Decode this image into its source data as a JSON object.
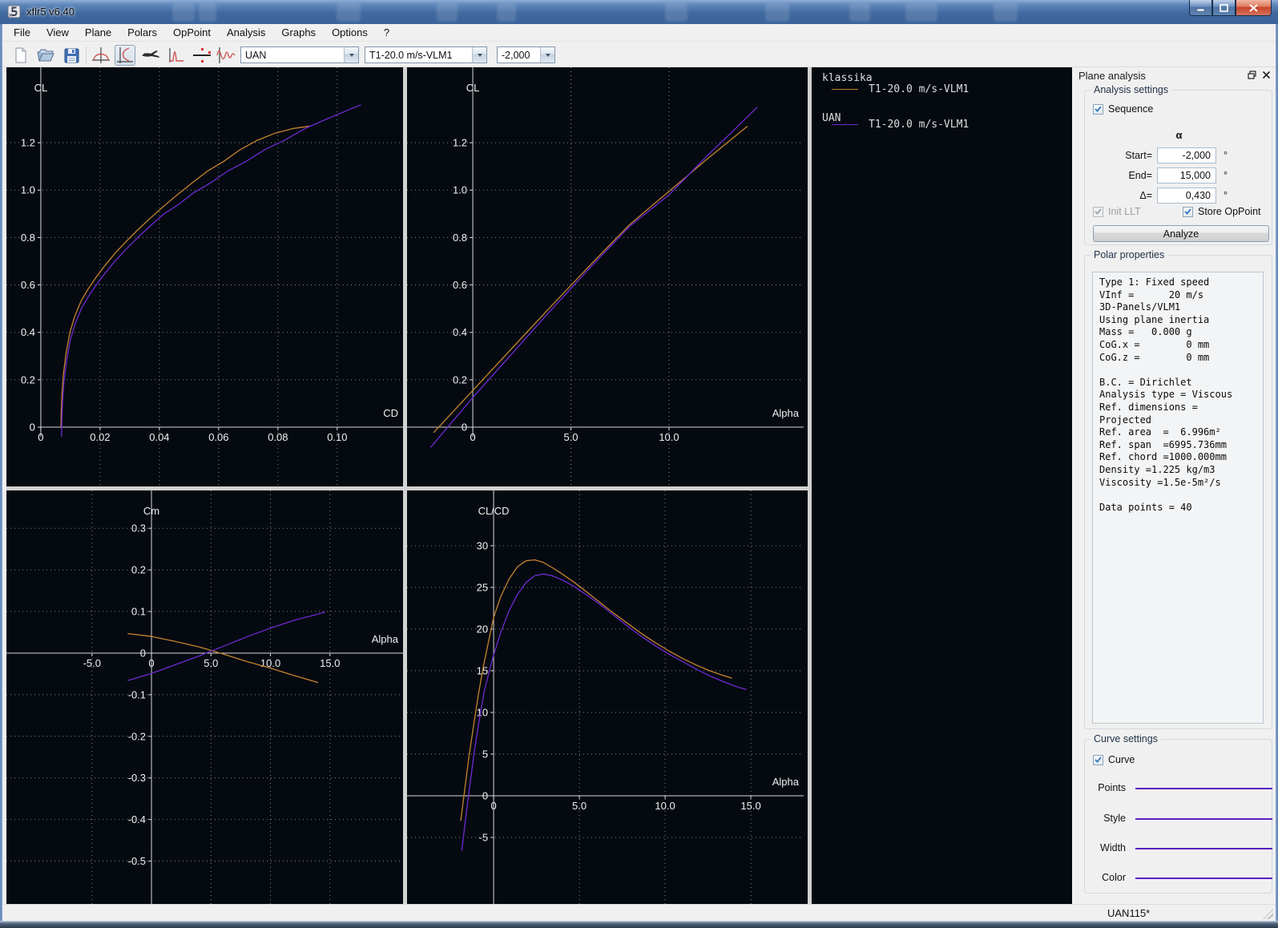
{
  "window": {
    "title": "xflr5 v6.40",
    "controls": [
      "minimize",
      "maximize",
      "close"
    ]
  },
  "menu": {
    "items": [
      "File",
      "View",
      "Plane",
      "Polars",
      "OpPoint",
      "Analysis",
      "Graphs",
      "Options",
      "?"
    ]
  },
  "toolbar": {
    "icons": [
      "new-file-icon",
      "open-file-icon",
      "save-icon",
      "foil-view-icon",
      "polar-view-icon",
      "plane-view-icon",
      "cp-view-icon",
      "oppoint-view-icon",
      "stability-view-icon"
    ],
    "selected_icon": "polar-view-icon",
    "combos": [
      {
        "name": "plane-select",
        "value": "UAN"
      },
      {
        "name": "polar-select",
        "value": "T1-20.0 m/s-VLM1"
      },
      {
        "name": "oppoint-select",
        "value": "-2,000"
      }
    ]
  },
  "legend": {
    "groups": [
      {
        "name": "klassika",
        "polar": "T1-20.0 m/s-VLM1",
        "color": "#c5842e"
      },
      {
        "name": "UAN",
        "polar": "T1-20.0 m/s-VLM1",
        "color": "#6f2ad2"
      }
    ]
  },
  "dock": {
    "title": "Plane analysis",
    "analysis_settings": {
      "title": "Analysis settings",
      "sequence_label": "Sequence",
      "alpha_symbol": "α",
      "rows": [
        {
          "label": "Start=",
          "value": "-2,000",
          "unit": "°"
        },
        {
          "label": "End=",
          "value": "15,000",
          "unit": "°"
        },
        {
          "label": "Δ=",
          "value": "0,430",
          "unit": "°"
        }
      ],
      "init_llt_label": "Init LLT",
      "store_oppoint_label": "Store OpPoint",
      "analyze_label": "Analyze"
    },
    "polar_properties": {
      "title": "Polar properties",
      "lines": [
        "Type 1: Fixed speed",
        "VInf =      20 m/s",
        "3D-Panels/VLM1",
        "Using plane inertia",
        "Mass =   0.000 g",
        "CoG.x =        0 mm",
        "CoG.z =        0 mm",
        "",
        "B.C. = Dirichlet",
        "Analysis type = Viscous",
        "Ref. dimensions =",
        "Projected",
        "Ref. area  =  6.996m²",
        "Ref. span  =6995.736mm",
        "Ref. chord =1000.000mm",
        "Density =1.225 kg/m3",
        "Viscosity =1.5e-5m²/s",
        "",
        "Data points = 40"
      ]
    },
    "curve_settings": {
      "title": "Curve settings",
      "curve_label": "Curve",
      "rows": [
        "Points",
        "Style",
        "Width",
        "Color"
      ],
      "line_color": "#5a1fc2"
    }
  },
  "statusbar": {
    "text": "UAN115*"
  },
  "colors": {
    "graph_background": "#050a11",
    "axis": "#d8d8d8",
    "grid": "#8a8a8a",
    "klassika": "#c5842e",
    "uan": "#6f2ad2"
  },
  "chart_data": [
    {
      "type": "line",
      "xlabel": "CD",
      "ylabel": "CL",
      "xlim": [
        -0.0116,
        0.1222
      ],
      "ylim": [
        -0.25,
        1.518
      ],
      "x_ticks": [
        {
          "v": 0,
          "l": "0"
        },
        {
          "v": 0.02,
          "l": "0.02"
        },
        {
          "v": 0.04,
          "l": "0.04"
        },
        {
          "v": 0.06,
          "l": "0.06"
        },
        {
          "v": 0.08,
          "l": "0.08"
        },
        {
          "v": 0.1,
          "l": "0.10"
        }
      ],
      "y_ticks": [
        {
          "v": 0,
          "l": "0"
        },
        {
          "v": 0.2,
          "l": "0.2"
        },
        {
          "v": 0.4,
          "l": "0.4"
        },
        {
          "v": 0.6,
          "l": "0.6"
        },
        {
          "v": 0.8,
          "l": "0.8"
        },
        {
          "v": 1.0,
          "l": "1.0"
        },
        {
          "v": 1.2,
          "l": "1.2"
        }
      ],
      "grid": "dotted",
      "x_axis_from_origin": true,
      "clip_y_axis": true,
      "series": [
        {
          "name": "klassika T1-20.0 m/s-VLM1",
          "color": "#c5842e",
          "points": [
            [
              0.0068,
              0
            ],
            [
              0.0069,
              0.06
            ],
            [
              0.0071,
              0.13
            ],
            [
              0.0076,
              0.22
            ],
            [
              0.0085,
              0.31
            ],
            [
              0.0098,
              0.4
            ],
            [
              0.0115,
              0.47
            ],
            [
              0.0135,
              0.53
            ],
            [
              0.0158,
              0.58
            ],
            [
              0.0185,
              0.63
            ],
            [
              0.0215,
              0.68
            ],
            [
              0.0248,
              0.73
            ],
            [
              0.0285,
              0.78
            ],
            [
              0.0325,
              0.83
            ],
            [
              0.0368,
              0.88
            ],
            [
              0.0413,
              0.93
            ],
            [
              0.046,
              0.98
            ],
            [
              0.051,
              1.03
            ],
            [
              0.0562,
              1.08
            ],
            [
              0.0616,
              1.12
            ],
            [
              0.0672,
              1.17
            ],
            [
              0.073,
              1.21
            ],
            [
              0.079,
              1.24
            ],
            [
              0.0852,
              1.26
            ],
            [
              0.0908,
              1.27
            ]
          ]
        },
        {
          "name": "UAN T1-20.0 m/s-VLM1",
          "color": "#6f2ad2",
          "points": [
            [
              0.007,
              -0.04
            ],
            [
              0.0071,
              0.03
            ],
            [
              0.0073,
              0.1
            ],
            [
              0.0078,
              0.19
            ],
            [
              0.0087,
              0.28
            ],
            [
              0.01,
              0.37
            ],
            [
              0.0117,
              0.44
            ],
            [
              0.0137,
              0.5
            ],
            [
              0.016,
              0.55
            ],
            [
              0.0187,
              0.6
            ],
            [
              0.0217,
              0.65
            ],
            [
              0.025,
              0.7
            ],
            [
              0.0287,
              0.75
            ],
            [
              0.0327,
              0.8
            ],
            [
              0.037,
              0.85
            ],
            [
              0.0416,
              0.9
            ],
            [
              0.0465,
              0.94
            ],
            [
              0.0517,
              0.99
            ],
            [
              0.0572,
              1.03
            ],
            [
              0.063,
              1.08
            ],
            [
              0.0691,
              1.12
            ],
            [
              0.0755,
              1.17
            ],
            [
              0.0822,
              1.21
            ],
            [
              0.0892,
              1.26
            ],
            [
              0.0965,
              1.3
            ],
            [
              0.1041,
              1.34
            ],
            [
              0.108,
              1.36
            ]
          ]
        }
      ]
    },
    {
      "type": "line",
      "xlabel": "Alpha",
      "ylabel": "CL",
      "xlim": [
        -3.35,
        16.86
      ],
      "ylim": [
        -0.25,
        1.518
      ],
      "x_ticks": [
        {
          "v": 0,
          "l": "0"
        },
        {
          "v": 5,
          "l": "5.0"
        },
        {
          "v": 10,
          "l": "10.0"
        }
      ],
      "y_ticks": [
        {
          "v": 0,
          "l": "0"
        },
        {
          "v": 0.2,
          "l": "0.2"
        },
        {
          "v": 0.4,
          "l": "0.4"
        },
        {
          "v": 0.6,
          "l": "0.6"
        },
        {
          "v": 0.8,
          "l": "0.8"
        },
        {
          "v": 1.0,
          "l": "1.0"
        },
        {
          "v": 1.2,
          "l": "1.2"
        }
      ],
      "grid": "dotted",
      "clip_y_axis": true,
      "series": [
        {
          "name": "klassika T1-20.0 m/s-VLM1",
          "color": "#c5842e",
          "points": [
            [
              -2,
              -0.023
            ],
            [
              0,
              0.155
            ],
            [
              2,
              0.333
            ],
            [
              4,
              0.511
            ],
            [
              6,
              0.685
            ],
            [
              8,
              0.855
            ],
            [
              10,
              0.995
            ],
            [
              12,
              1.135
            ],
            [
              14,
              1.27
            ]
          ]
        },
        {
          "name": "UAN T1-20.0 m/s-VLM1",
          "color": "#6f2ad2",
          "points": [
            [
              -2.15,
              -0.085
            ],
            [
              0,
              0.125
            ],
            [
              2,
              0.31
            ],
            [
              4,
              0.495
            ],
            [
              6,
              0.675
            ],
            [
              8,
              0.848
            ],
            [
              10,
              0.98
            ],
            [
              12,
              1.15
            ],
            [
              13.2,
              1.245
            ],
            [
              14.5,
              1.35
            ]
          ]
        }
      ]
    },
    {
      "type": "line",
      "xlabel": "Alpha",
      "ylabel": "Cm",
      "xlim": [
        -12.19,
        21.14
      ],
      "ylim": [
        -0.603,
        0.391
      ],
      "x_ticks": [
        {
          "v": -5,
          "l": "-5.0"
        },
        {
          "v": 0,
          "l": "0"
        },
        {
          "v": 5,
          "l": "5.0"
        },
        {
          "v": 10,
          "l": "10.0"
        },
        {
          "v": 15,
          "l": "15.0"
        }
      ],
      "y_ticks": [
        {
          "v": 0.3,
          "l": "0.3"
        },
        {
          "v": 0.2,
          "l": "0.2"
        },
        {
          "v": 0.1,
          "l": "0.1"
        },
        {
          "v": 0,
          "l": "0"
        },
        {
          "v": -0.1,
          "l": "-0.1"
        },
        {
          "v": -0.2,
          "l": "-0.2"
        },
        {
          "v": -0.3,
          "l": "-0.3"
        },
        {
          "v": -0.4,
          "l": "-0.4"
        },
        {
          "v": -0.5,
          "l": "-0.5"
        }
      ],
      "grid": "dotted",
      "series": [
        {
          "name": "klassika T1-20.0 m/s-VLM1",
          "color": "#c5842e",
          "points": [
            [
              -2,
              0.047
            ],
            [
              0,
              0.04
            ],
            [
              2,
              0.028
            ],
            [
              4,
              0.015
            ],
            [
              6,
              -0.002
            ],
            [
              8,
              -0.02
            ],
            [
              10,
              -0.036
            ],
            [
              12,
              -0.054
            ],
            [
              14,
              -0.071
            ]
          ]
        },
        {
          "name": "UAN T1-20.0 m/s-VLM1",
          "color": "#6f2ad2",
          "points": [
            [
              -2,
              -0.066
            ],
            [
              0,
              -0.049
            ],
            [
              2,
              -0.028
            ],
            [
              4,
              -0.007
            ],
            [
              6,
              0.016
            ],
            [
              8,
              0.039
            ],
            [
              10,
              0.06
            ],
            [
              12,
              0.079
            ],
            [
              14,
              0.094
            ],
            [
              14.6,
              0.099
            ]
          ]
        }
      ]
    },
    {
      "type": "line",
      "xlabel": "Alpha",
      "ylabel": "CL/CD",
      "xlim": [
        -5.05,
        18.08
      ],
      "ylim": [
        -12.98,
        36.63
      ],
      "x_ticks": [
        {
          "v": 0,
          "l": "0"
        },
        {
          "v": 5,
          "l": "5.0"
        },
        {
          "v": 10,
          "l": "10.0"
        },
        {
          "v": 15,
          "l": "15.0"
        }
      ],
      "y_ticks": [
        {
          "v": -5,
          "l": "-5"
        },
        {
          "v": 0,
          "l": "0"
        },
        {
          "v": 5,
          "l": "5"
        },
        {
          "v": 10,
          "l": "10"
        },
        {
          "v": 15,
          "l": "15"
        },
        {
          "v": 20,
          "l": "20"
        },
        {
          "v": 25,
          "l": "25"
        },
        {
          "v": 30,
          "l": "30"
        }
      ],
      "grid": "dotted",
      "series": [
        {
          "name": "klassika T1-20.0 m/s-VLM1",
          "color": "#c5842e",
          "points": [
            [
              -1.92,
              -3
            ],
            [
              -1.7,
              0.5
            ],
            [
              -1.45,
              4.5
            ],
            [
              -1.2,
              8
            ],
            [
              -0.9,
              12
            ],
            [
              -0.6,
              15.5
            ],
            [
              -0.3,
              18.5
            ],
            [
              0,
              21.4
            ],
            [
              0.4,
              23.8
            ],
            [
              0.9,
              26
            ],
            [
              1.4,
              27.5
            ],
            [
              1.9,
              28.2
            ],
            [
              2.4,
              28.3
            ],
            [
              2.9,
              28
            ],
            [
              3.4,
              27.4
            ],
            [
              4,
              26.6
            ],
            [
              4.7,
              25.6
            ],
            [
              5.4,
              24.5
            ],
            [
              6.2,
              23.2
            ],
            [
              7,
              21.9
            ],
            [
              7.8,
              20.7
            ],
            [
              8.6,
              19.5
            ],
            [
              9.4,
              18.4
            ],
            [
              10.2,
              17.4
            ],
            [
              11,
              16.5
            ],
            [
              11.8,
              15.7
            ],
            [
              12.6,
              15
            ],
            [
              13.3,
              14.5
            ],
            [
              13.9,
              14.1
            ]
          ]
        },
        {
          "name": "UAN T1-20.0 m/s-VLM1",
          "color": "#6f2ad2",
          "points": [
            [
              -1.86,
              -6.6
            ],
            [
              -1.65,
              -3
            ],
            [
              -1.4,
              1
            ],
            [
              -1.15,
              5
            ],
            [
              -0.85,
              9
            ],
            [
              -0.55,
              12.5
            ],
            [
              -0.25,
              15
            ],
            [
              0,
              16.9
            ],
            [
              0.45,
              19.8
            ],
            [
              0.9,
              22.2
            ],
            [
              1.4,
              24.2
            ],
            [
              1.9,
              25.6
            ],
            [
              2.4,
              26.4
            ],
            [
              2.9,
              26.6
            ],
            [
              3.4,
              26.4
            ],
            [
              4,
              25.9
            ],
            [
              4.7,
              25.1
            ],
            [
              5.5,
              24
            ],
            [
              6.3,
              22.8
            ],
            [
              7.1,
              21.5
            ],
            [
              7.9,
              20.2
            ],
            [
              8.7,
              19
            ],
            [
              9.5,
              17.9
            ],
            [
              10.3,
              16.9
            ],
            [
              11.1,
              16
            ],
            [
              11.9,
              15.1
            ],
            [
              12.7,
              14.3
            ],
            [
              13.5,
              13.6
            ],
            [
              14.3,
              13
            ],
            [
              14.75,
              12.75
            ]
          ]
        }
      ]
    }
  ]
}
